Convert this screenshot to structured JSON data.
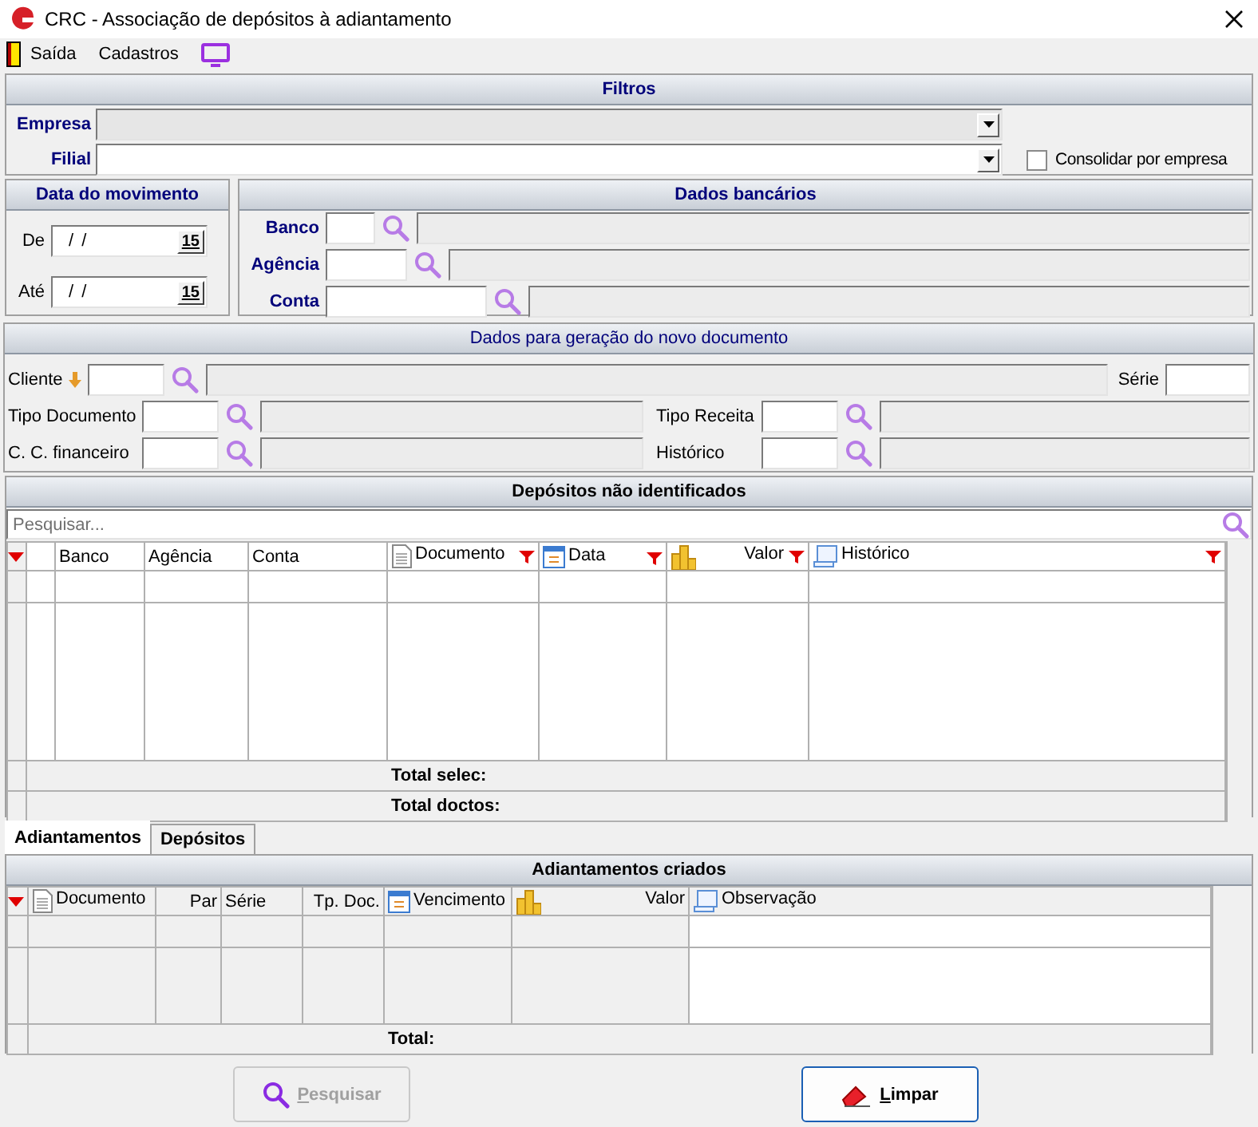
{
  "window": {
    "title": "CRC - Associação de depósitos à adiantamento"
  },
  "menu": [
    {
      "label": "Saída",
      "kind": "exit"
    },
    {
      "label": "Cadastros",
      "kind": "plain"
    }
  ],
  "filters": {
    "title": "Filtros",
    "fields": [
      {
        "label": "Empresa",
        "disabled": true
      },
      {
        "label": "Filial",
        "disabled": false
      }
    ],
    "consolidate": {
      "label": "Consolidar por empresa",
      "checked": false
    }
  },
  "date_panel": {
    "title": "Data do movimento",
    "fields": [
      {
        "label": "De",
        "value": "/ /",
        "button": "15"
      },
      {
        "label": "Até",
        "value": "/ /",
        "button": "15"
      }
    ]
  },
  "bank": {
    "title": "Dados bancários",
    "fields": [
      {
        "label": "Banco"
      },
      {
        "label": "Agência"
      },
      {
        "label": "Conta"
      }
    ]
  },
  "new_doc": {
    "title": "Dados para geração do novo documento",
    "client": {
      "label": "Cliente"
    },
    "series": {
      "label": "Série"
    },
    "rows": [
      [
        {
          "label": "Tipo Documento"
        },
        {
          "label": "Tipo Receita"
        }
      ],
      [
        {
          "label": "C. C. financeiro"
        },
        {
          "label": "Histórico"
        }
      ]
    ]
  },
  "deposits": {
    "title": "Depósitos não identificados",
    "search": {
      "placeholder": "Pesquisar..."
    },
    "columns": [
      {
        "label": "Banco",
        "kind": "plain",
        "filter": false,
        "numeric": false
      },
      {
        "label": "Agência",
        "kind": "plain",
        "filter": false,
        "numeric": false
      },
      {
        "label": "Conta",
        "kind": "plain",
        "filter": false,
        "numeric": false
      },
      {
        "label": "Documento",
        "kind": "document",
        "filter": true,
        "numeric": false
      },
      {
        "label": "Data",
        "kind": "calendar",
        "filter": true,
        "numeric": false
      },
      {
        "label": "Valor",
        "kind": "coins",
        "filter": true,
        "numeric": true
      },
      {
        "label": "Histórico",
        "kind": "scroll",
        "filter": true,
        "numeric": false
      }
    ],
    "totals": [
      "Total selec:",
      "Total doctos:"
    ]
  },
  "tabs": [
    {
      "label": "Adiantamentos",
      "selected": true
    },
    {
      "label": "Depósitos",
      "selected": false
    }
  ],
  "advances": {
    "title": "Adiantamentos criados",
    "columns": [
      {
        "label": "Documento",
        "kind": "document",
        "numeric": false
      },
      {
        "label": "Par",
        "kind": "plain",
        "numeric": true
      },
      {
        "label": "Série",
        "kind": "plain",
        "numeric": false
      },
      {
        "label": "Tp. Doc.",
        "kind": "plain",
        "numeric": true
      },
      {
        "label": "Vencimento",
        "kind": "calendar",
        "numeric": false
      },
      {
        "label": "Valor",
        "kind": "coins",
        "numeric": true
      },
      {
        "label": "Observação",
        "kind": "scroll",
        "numeric": false
      }
    ],
    "total": "Total:"
  },
  "buttons": [
    {
      "label": "Pesquisar",
      "kind": "search",
      "disabled": true
    },
    {
      "label": "Limpar",
      "kind": "clear",
      "disabled": false
    }
  ]
}
